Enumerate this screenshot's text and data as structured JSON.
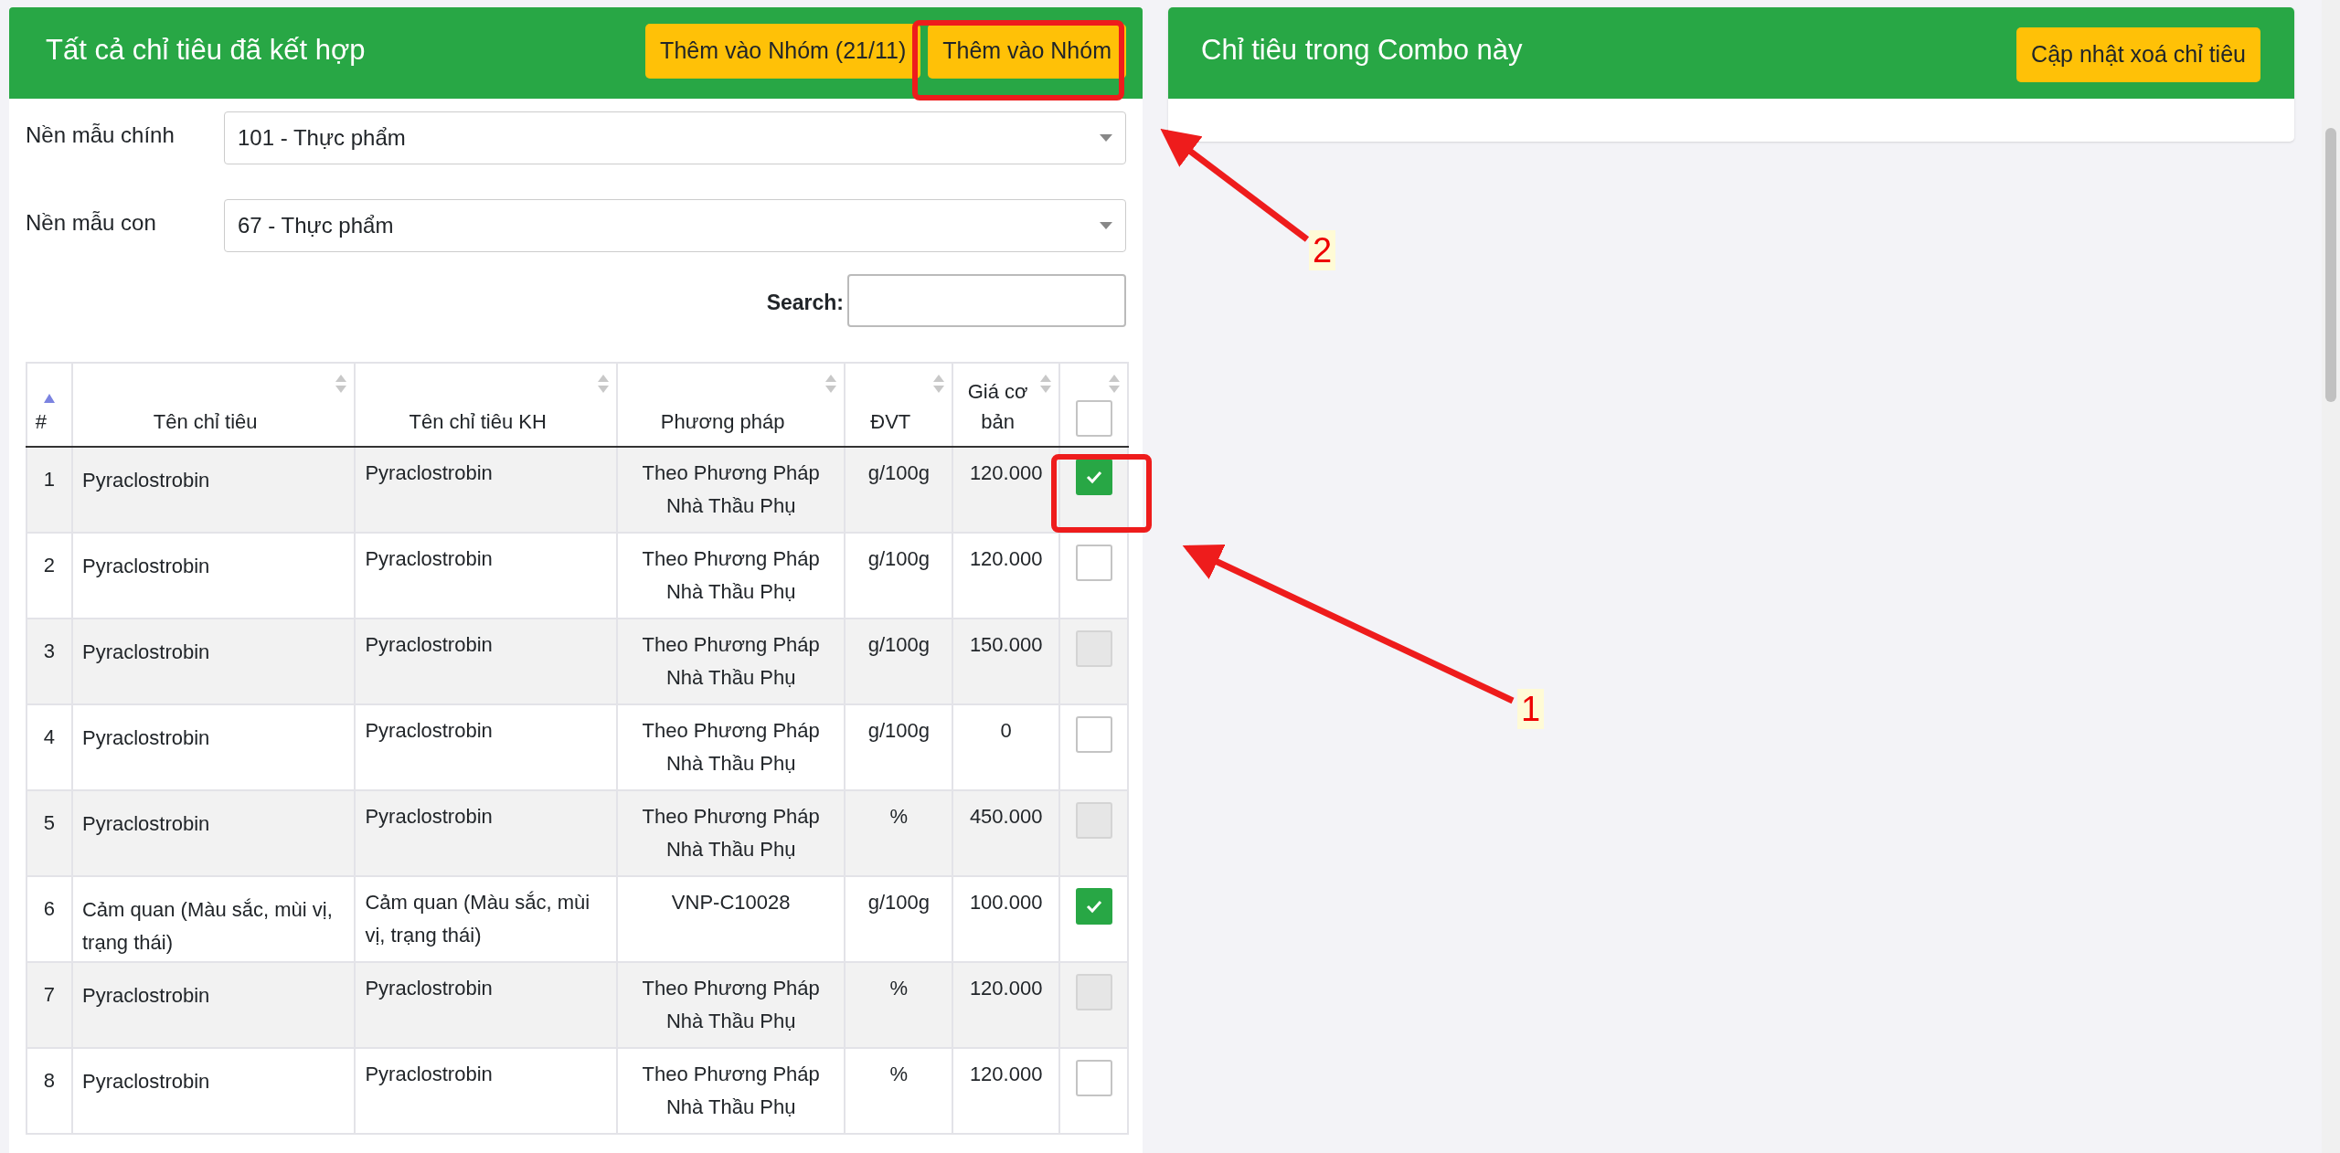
{
  "left_panel": {
    "title": "Tất cả chỉ tiêu đã kết hợp",
    "buttons": [
      "Thêm vào Nhóm (21/11)",
      "Thêm vào Nhóm"
    ],
    "filters": [
      {
        "label": "Nền mẫu chính",
        "value": "101 - Thực phẩm"
      },
      {
        "label": "Nền mẫu con",
        "value": "67 - Thực phẩm"
      }
    ],
    "search": {
      "label": "Search:"
    },
    "table": {
      "columns": [
        {
          "label": "#",
          "sorted": true
        },
        {
          "label": "Tên chỉ tiêu",
          "sorted": false
        },
        {
          "label": "Tên chỉ tiêu KH",
          "sorted": false
        },
        {
          "label": "Phương pháp",
          "sorted": false
        },
        {
          "label": "ĐVT",
          "sorted": false
        },
        {
          "label": "Giá cơ bản",
          "sorted": false
        },
        {
          "sorted": false,
          "kind": "checkbox",
          "checked": false
        }
      ],
      "rows": [
        {
          "no": "1",
          "name": "Pyraclostrobin",
          "name_kh": "Pyraclostrobin",
          "method": "Theo Phương Pháp Nhà Thầu Phụ",
          "unit": "g/100g",
          "price": "120.000",
          "checked": true,
          "disabled": false
        },
        {
          "no": "2",
          "name": "Pyraclostrobin",
          "name_kh": "Pyraclostrobin",
          "method": "Theo Phương Pháp Nhà Thầu Phụ",
          "unit": "g/100g",
          "price": "120.000",
          "checked": false,
          "disabled": false
        },
        {
          "no": "3",
          "name": "Pyraclostrobin",
          "name_kh": "Pyraclostrobin",
          "method": "Theo Phương Pháp Nhà Thầu Phụ",
          "unit": "g/100g",
          "price": "150.000",
          "checked": false,
          "disabled": true
        },
        {
          "no": "4",
          "name": "Pyraclostrobin",
          "name_kh": "Pyraclostrobin",
          "method": "Theo Phương Pháp Nhà Thầu Phụ",
          "unit": "g/100g",
          "price": "0",
          "checked": false,
          "disabled": false
        },
        {
          "no": "5",
          "name": "Pyraclostrobin",
          "name_kh": "Pyraclostrobin",
          "method": "Theo Phương Pháp Nhà Thầu Phụ",
          "unit": "%",
          "price": "450.000",
          "checked": false,
          "disabled": true
        },
        {
          "no": "6",
          "name": "Cảm quan (Màu sắc, mùi vị, trạng thái)",
          "name_kh": "Cảm quan (Màu sắc, mùi vị, trạng thái)",
          "method": "VNP-C10028",
          "unit": "g/100g",
          "price": "100.000",
          "checked": true,
          "disabled": false
        },
        {
          "no": "7",
          "name": "Pyraclostrobin",
          "name_kh": "Pyraclostrobin",
          "method": "Theo Phương Pháp Nhà Thầu Phụ",
          "unit": "%",
          "price": "120.000",
          "checked": false,
          "disabled": true
        },
        {
          "no": "8",
          "name": "Pyraclostrobin",
          "name_kh": "Pyraclostrobin",
          "method": "Theo Phương Pháp Nhà Thầu Phụ",
          "unit": "%",
          "price": "120.000",
          "checked": false,
          "disabled": false
        }
      ]
    }
  },
  "right_panel": {
    "title": "Chỉ tiêu trong Combo này",
    "button": "Cập nhật xoá chỉ tiêu"
  },
  "annotations": [
    {
      "label": "2"
    },
    {
      "label": "1"
    }
  ]
}
